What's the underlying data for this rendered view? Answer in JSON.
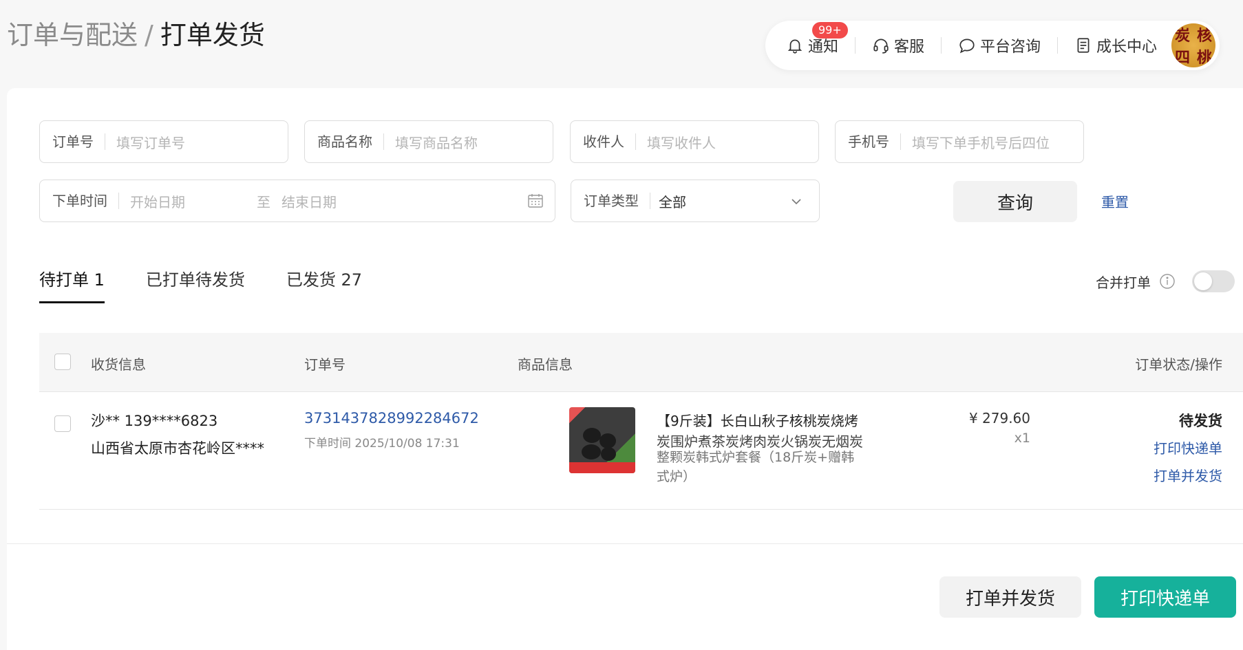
{
  "breadcrumb": {
    "parent": "订单与配送",
    "separator": "/",
    "current": "打单发货"
  },
  "topbar": {
    "notice_label": "通知",
    "notice_badge": "99+",
    "service_label": "客服",
    "consult_label": "平台咨询",
    "growth_label": "成长中心",
    "avatar_chars": [
      "炭",
      "核",
      "四",
      "桃"
    ]
  },
  "filters": {
    "order_no_label": "订单号",
    "order_no_placeholder": "填写订单号",
    "product_label": "商品名称",
    "product_placeholder": "填写商品名称",
    "receiver_label": "收件人",
    "receiver_placeholder": "填写收件人",
    "phone_label": "手机号",
    "phone_placeholder": "填写下单手机号后四位",
    "time_label": "下单时间",
    "start_placeholder": "开始日期",
    "to": "至",
    "end_placeholder": "结束日期",
    "type_label": "订单类型",
    "type_value": "全部",
    "query_label": "查询",
    "reset_label": "重置"
  },
  "tabs": [
    {
      "label": "待打单 1",
      "active": true
    },
    {
      "label": "已打单待发货",
      "active": false
    },
    {
      "label": "已发货 27",
      "active": false
    }
  ],
  "merge": {
    "label": "合并打单",
    "enabled": false
  },
  "table": {
    "headers": {
      "receiver": "收货信息",
      "order_no": "订单号",
      "product": "商品信息",
      "status": "订单状态/操作"
    },
    "rows": [
      {
        "receiver_name": "沙** 139****6823",
        "address": "山西省太原市杏花岭区****",
        "order_no": "3731437828992284672",
        "order_time": "下单时间 2025/10/08 17:31",
        "product_line1": "【9斤装】长白山秋子核桃炭烧烤",
        "product_line2": "炭围炉煮茶炭烤肉炭火锅炭无烟炭",
        "product_line3": "整颗炭韩式炉套餐（18斤炭+赠韩",
        "product_line4": "式炉）",
        "price": "¥ 279.60",
        "qty": "x1",
        "status": "待发货",
        "action1": "打印快递单",
        "action2": "打单并发货"
      }
    ]
  },
  "footer": {
    "print_ship_label": "打单并发货",
    "print_label_label": "打印快递单"
  },
  "colors": {
    "accent": "#16b19b",
    "link": "#2e5aa8",
    "badge": "#f24a4a"
  }
}
